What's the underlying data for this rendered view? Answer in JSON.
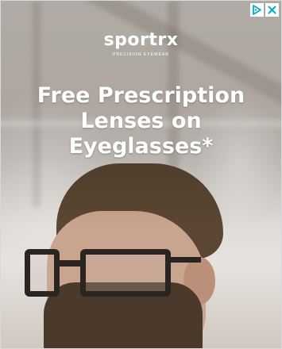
{
  "ad": {
    "brand": "sportrx",
    "tagline": "PRECISION EYEWEAR",
    "headline_lines": [
      "Free Prescription",
      "Lenses on",
      "Eyeglasses*"
    ]
  },
  "adchoices": {
    "info_icon": "adchoices-triangle-icon",
    "close_icon": "close-icon",
    "accent_color": "#00aecd"
  }
}
